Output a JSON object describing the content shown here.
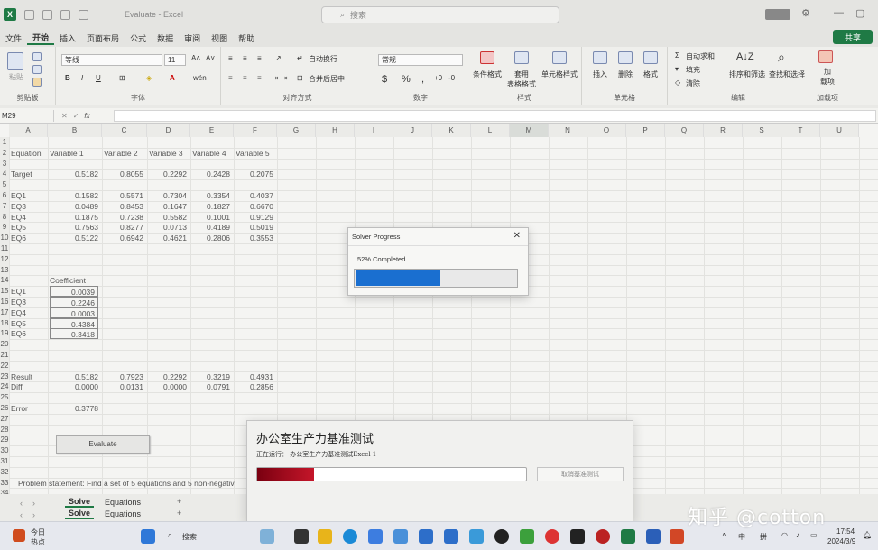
{
  "window": {
    "title": "Evaluate - Excel",
    "search_placeholder": "搜索"
  },
  "menu": {
    "tabs": [
      "文件",
      "开始",
      "插入",
      "页面布局",
      "公式",
      "数据",
      "审阅",
      "视图",
      "帮助"
    ],
    "share": "共享"
  },
  "ribbon": {
    "clipboard": {
      "label": "剪贴板",
      "paste": "粘贴"
    },
    "font": {
      "label": "字体",
      "name": "等线",
      "size": "11"
    },
    "alignment": {
      "label": "对齐方式",
      "wrap": "自动换行",
      "merge": "合并后居中"
    },
    "number": {
      "label": "数字",
      "format": "常规"
    },
    "styles": {
      "label": "样式",
      "cond": "条件格式",
      "table": "套用\n表格格式",
      "cell": "单元格样式"
    },
    "cells": {
      "label": "单元格",
      "insert": "插入",
      "delete": "删除",
      "format": "格式"
    },
    "editing": {
      "label": "编辑",
      "autosum": "自动求和",
      "fill": "填充",
      "clear": "清除",
      "sort": "排序和筛选",
      "find": "查找和选择"
    },
    "addins": {
      "label": "加载项",
      "btn": "加\n载项"
    }
  },
  "formula_bar": {
    "name_box": "M29",
    "fx": "fx"
  },
  "columns": [
    "A",
    "B",
    "C",
    "D",
    "E",
    "F",
    "G",
    "H",
    "I",
    "J",
    "K",
    "L",
    "M",
    "N",
    "O",
    "P",
    "Q",
    "R",
    "S",
    "T",
    "U"
  ],
  "rows": [
    "1",
    "2",
    "3",
    "4",
    "5",
    "6",
    "7",
    "8",
    "9",
    "10",
    "11",
    "12",
    "13",
    "14",
    "15",
    "16",
    "17",
    "18",
    "19",
    "20",
    "21",
    "22",
    "23",
    "24",
    "25",
    "26",
    "27",
    "28",
    "29",
    "30",
    "31",
    "32",
    "33",
    "34",
    "35"
  ],
  "sheet": {
    "headers": [
      "Equation",
      "Variable 1",
      "Variable 2",
      "Variable 3",
      "Variable 4",
      "Variable 5"
    ],
    "target": {
      "label": "Target",
      "values": [
        "0.5182",
        "0.8055",
        "0.2292",
        "0.2428",
        "0.2075"
      ]
    },
    "equations": [
      {
        "label": "EQ1",
        "values": [
          "0.1582",
          "0.5571",
          "0.7304",
          "0.3354",
          "0.4037"
        ]
      },
      {
        "label": "EQ3",
        "values": [
          "0.0489",
          "0.8453",
          "0.1647",
          "0.1827",
          "0.6670"
        ]
      },
      {
        "label": "EQ4",
        "values": [
          "0.1875",
          "0.7238",
          "0.5582",
          "0.1001",
          "0.9129"
        ]
      },
      {
        "label": "EQ5",
        "values": [
          "0.7563",
          "0.8277",
          "0.0713",
          "0.4189",
          "0.5019"
        ]
      },
      {
        "label": "EQ6",
        "values": [
          "0.5122",
          "0.6942",
          "0.4621",
          "0.2806",
          "0.3553"
        ]
      }
    ],
    "coefficient_header": "Coefficient",
    "coefficients": [
      {
        "label": "EQ1",
        "value": "0.0039"
      },
      {
        "label": "EQ3",
        "value": "0.2246"
      },
      {
        "label": "EQ4",
        "value": "0.0003"
      },
      {
        "label": "EQ5",
        "value": "0.4384"
      },
      {
        "label": "EQ6",
        "value": "0.3418"
      }
    ],
    "result": {
      "label": "Result",
      "values": [
        "0.5182",
        "0.7923",
        "0.2292",
        "0.3219",
        "0.4931"
      ]
    },
    "diff": {
      "label": "Diff",
      "values": [
        "0.0000",
        "0.0131",
        "0.0000",
        "0.0791",
        "0.2856"
      ]
    },
    "error": {
      "label": "Error",
      "value": "0.3778"
    },
    "evaluate_button": "Evaluate",
    "problem": "Problem statement: Find a set of 5 equations and 5 non-negativ"
  },
  "sheet_tabs": [
    "Solve",
    "Equations"
  ],
  "solver_dialog": {
    "title": "Solver Progress",
    "status": "52% Completed",
    "progress": 0.52
  },
  "benchmark": {
    "title": "办公室生产力基准测试",
    "running": "正在运行： 办公室生产力基准测试Excel 1",
    "progress": 0.21,
    "cancel": "取消基准测试"
  },
  "taskbar": {
    "weather_top": "今日",
    "weather_bottom": "热点",
    "search": "搜索",
    "ime1": "中",
    "ime2": "拼",
    "time": "17:54",
    "date": "2024/3/9"
  },
  "watermark": "知乎 @cotton",
  "colors": {
    "accent": "#1f7a45",
    "solver_bar": "#1a6fd0",
    "bench_bar": "#b0101f"
  }
}
